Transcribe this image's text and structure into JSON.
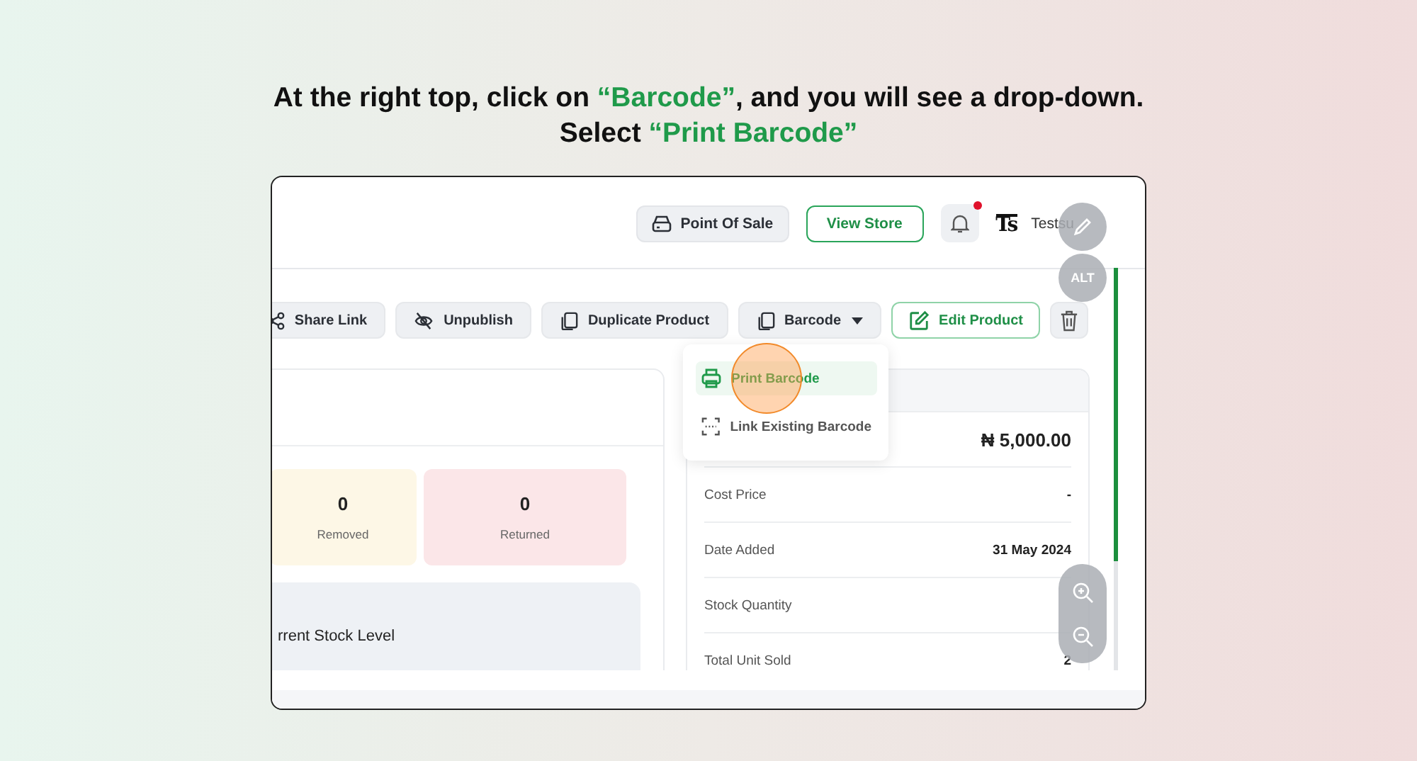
{
  "instruction": {
    "lines": [
      [
        {
          "text": "At the right top, click on ",
          "highlight": false
        },
        {
          "text": "“Barcode”",
          "highlight": true
        },
        {
          "text": ", and you will see a drop-down.",
          "highlight": false
        }
      ],
      [
        {
          "text": "Select ",
          "highlight": false
        },
        {
          "text": "“Print Barcode”",
          "highlight": true
        }
      ]
    ]
  },
  "screen": {
    "header_buttons": [
      {
        "label": "Point Of Sale",
        "kind": "pos"
      },
      {
        "label": "View Store",
        "kind": "outline"
      }
    ],
    "notifications": {
      "unread": true
    },
    "user": {
      "logo": "Ts",
      "name": "Testsu"
    },
    "actions": [
      {
        "label": "Share Link",
        "kind": "share"
      },
      {
        "label": "Unpublish",
        "kind": "unpublish"
      },
      {
        "label": "Duplicate Product",
        "kind": "duplicate"
      },
      {
        "label": "Barcode",
        "kind": "dropdown",
        "expanded": true
      },
      {
        "label": "Edit Product",
        "kind": "edit"
      },
      {
        "kind": "delete"
      }
    ],
    "dropdown": [
      {
        "label": "Print Barcode",
        "selected": true,
        "click_marker": true
      },
      {
        "label": "Link Existing Barcode",
        "selected": false,
        "click_marker": false
      }
    ],
    "stats": [
      {
        "value": "0",
        "label": "Removed",
        "color": "#fdf7e6"
      },
      {
        "value": "0",
        "label": "Returned",
        "color": "#fbe6e8"
      }
    ],
    "stock_panel": {
      "title": "rrent Stock Level"
    },
    "details": [
      {
        "value": "₦ 5,000.00",
        "kind": "price"
      },
      {
        "label": "Cost Price",
        "value": "-",
        "kind": "row"
      },
      {
        "label": "Date Added",
        "value": "31 May 2024",
        "kind": "row"
      },
      {
        "label": "Stock Quantity",
        "kind": "row"
      },
      {
        "label": "Total Unit Sold",
        "value": "2",
        "kind": "row"
      }
    ],
    "floating": {
      "alt": "ALT"
    }
  }
}
